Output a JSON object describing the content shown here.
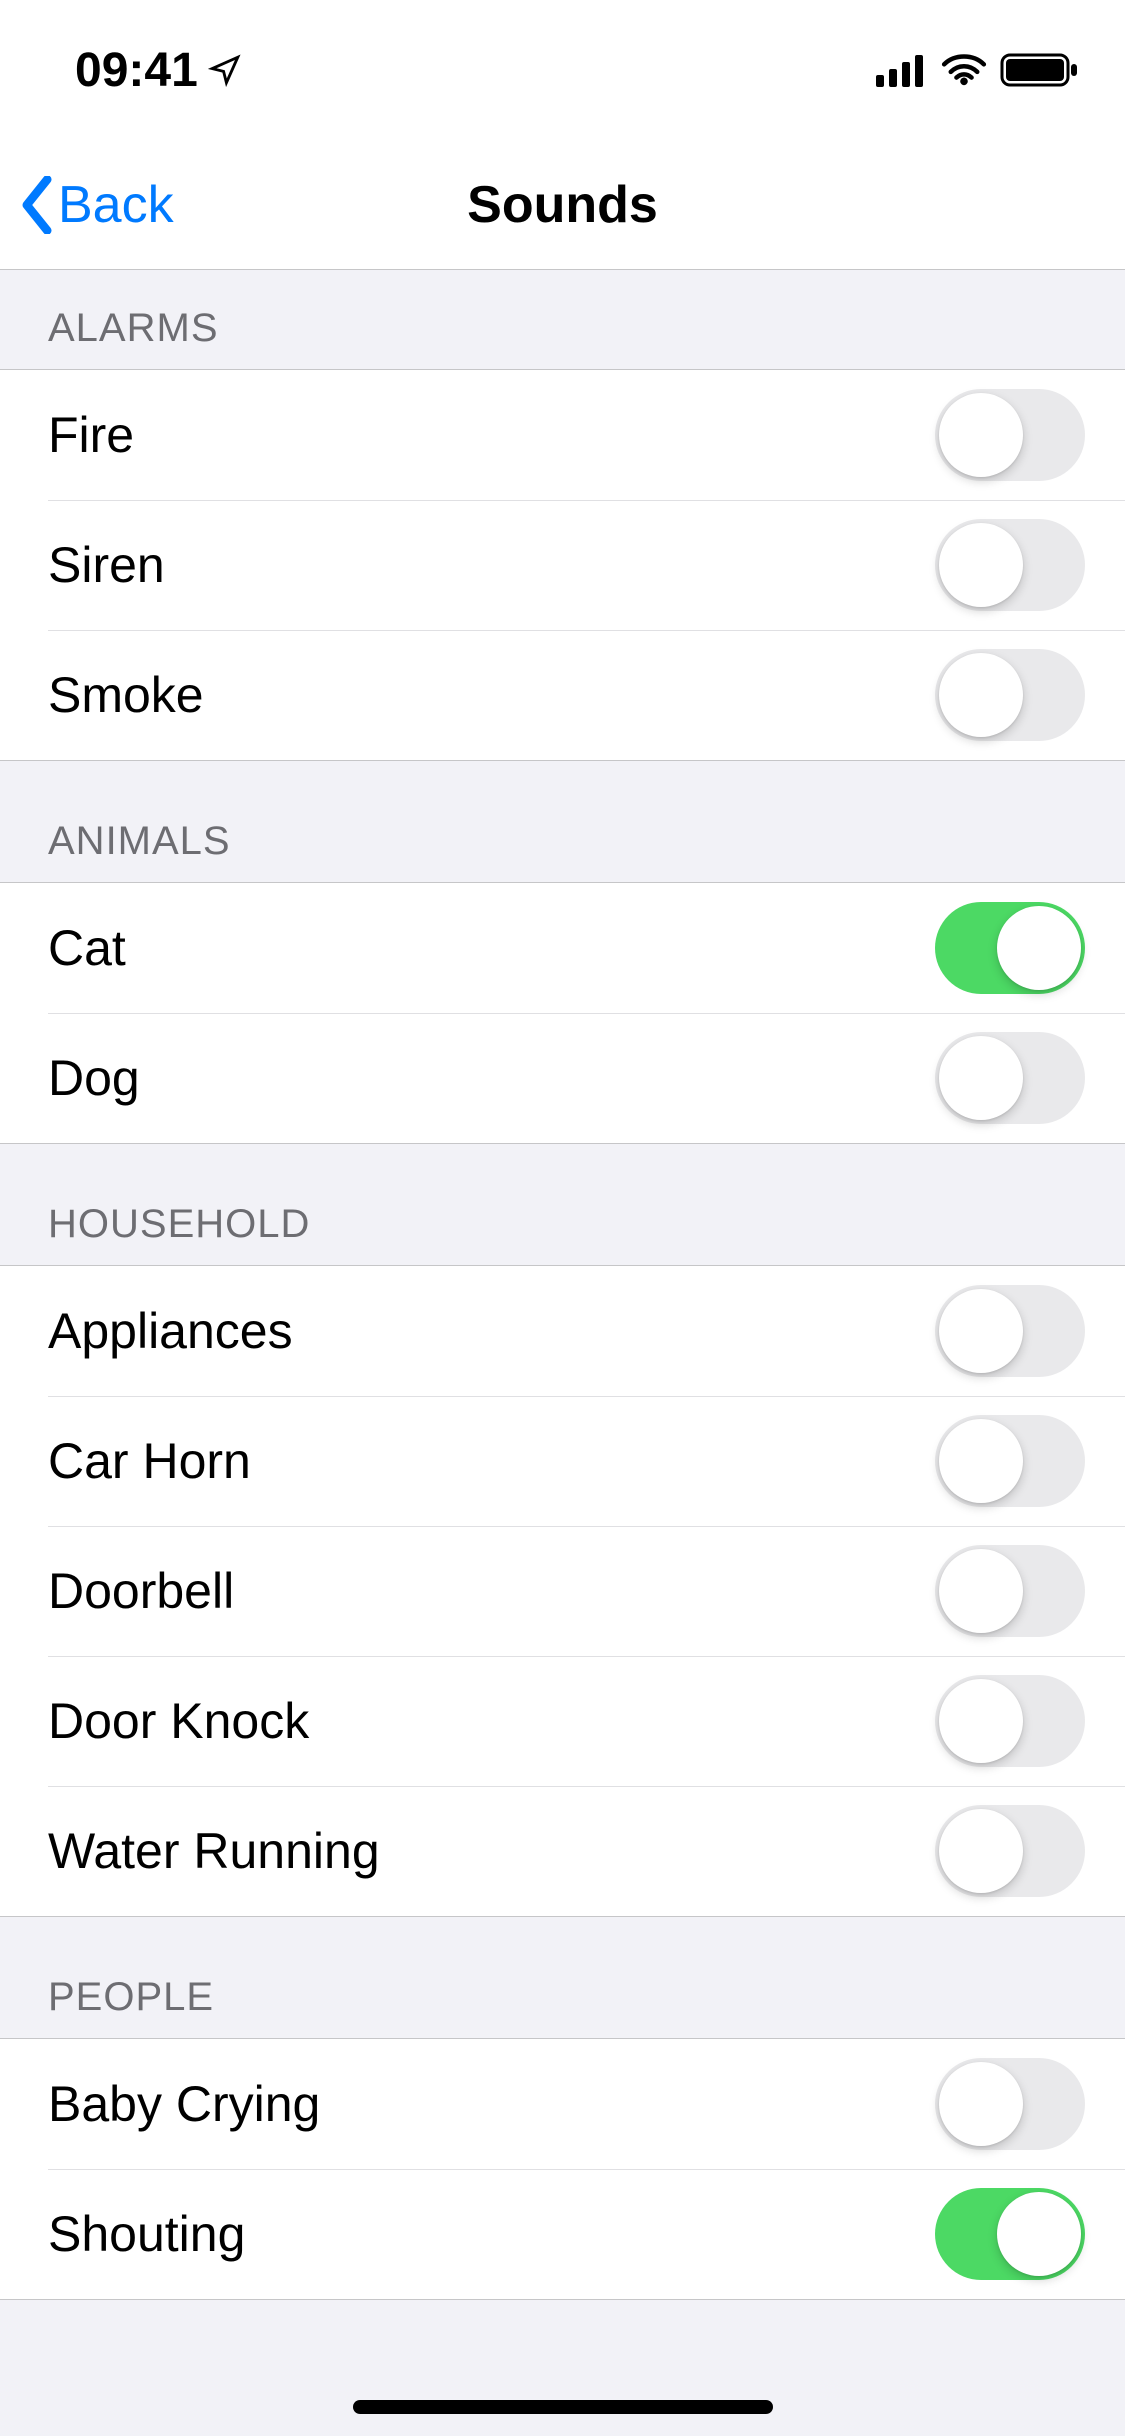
{
  "status": {
    "time": "09:41"
  },
  "nav": {
    "back_label": "Back",
    "title": "Sounds"
  },
  "sections": [
    {
      "id": "alarms",
      "header": "Alarms",
      "items": [
        {
          "id": "fire",
          "label": "Fire",
          "on": false
        },
        {
          "id": "siren",
          "label": "Siren",
          "on": false
        },
        {
          "id": "smoke",
          "label": "Smoke",
          "on": false
        }
      ]
    },
    {
      "id": "animals",
      "header": "Animals",
      "items": [
        {
          "id": "cat",
          "label": "Cat",
          "on": true
        },
        {
          "id": "dog",
          "label": "Dog",
          "on": false
        }
      ]
    },
    {
      "id": "household",
      "header": "Household",
      "items": [
        {
          "id": "appliances",
          "label": "Appliances",
          "on": false
        },
        {
          "id": "car-horn",
          "label": "Car Horn",
          "on": false
        },
        {
          "id": "doorbell",
          "label": "Doorbell",
          "on": false
        },
        {
          "id": "door-knock",
          "label": "Door Knock",
          "on": false
        },
        {
          "id": "water-running",
          "label": "Water Running",
          "on": false
        }
      ]
    },
    {
      "id": "people",
      "header": "People",
      "items": [
        {
          "id": "baby-crying",
          "label": "Baby Crying",
          "on": false
        },
        {
          "id": "shouting",
          "label": "Shouting",
          "on": true
        }
      ]
    }
  ]
}
